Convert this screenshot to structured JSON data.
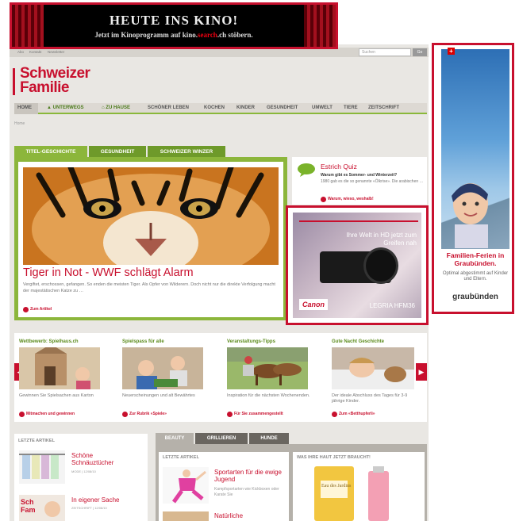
{
  "top_ad": {
    "headline": "HEUTE INS KINO!",
    "sub_pre": "Jetzt im Kinoprogramm auf kino.",
    "sub_brand": "search",
    "sub_post": ".ch stöbern."
  },
  "sky_ad": {
    "headline": "Familien-Ferien in Graubünden.",
    "sub": "Optimal abgestimmt auf Kinder und Eltern.",
    "logo": "graubünden"
  },
  "util": {
    "links": [
      "Abo",
      "Kontakt",
      "Newsletter"
    ],
    "search_placeholder": "Suchen",
    "go": "Go"
  },
  "logo": {
    "line1": "Schweizer",
    "line2": "Familie"
  },
  "nav": [
    "HOME",
    "UNTERWEGS",
    "ZU HAUSE",
    "SCHÖNER LEBEN",
    "KOCHEN",
    "KINDER",
    "GESUNDHEIT",
    "UMWELT",
    "TIERE",
    "ZEITSCHRIFT"
  ],
  "breadcrumb": "Home",
  "feature": {
    "tabs": [
      "TITEL-GESCHICHTE",
      "GESUNDHEIT",
      "SCHWEIZER WINZER"
    ],
    "title": "Tiger in Not - WWF schlägt Alarm",
    "text": "Vergiftet, erschossen, gefangen. So enden die meisten Tiger. Als Opfer von Wilderern. Doch nicht nur die direkte Verfolgung macht der majestätischen Katze zu …",
    "more": "Zum Artikel"
  },
  "quiz": {
    "title": "Estrich Quiz",
    "question": "Warum gibt es Sommer- und Winterzeit?",
    "desc": "1980 gab es die so genannte «Ölkrise». Die arabischen …",
    "more": "Warum, wieso, weshalb!"
  },
  "canon": {
    "headline": "Ihre Welt in HD jetzt zum Greifen nah",
    "brand": "Canon",
    "model": "LEGRIA HFM36"
  },
  "teasers": [
    {
      "title": "Wettbewerb: Spielhaus.ch",
      "desc": "Gewinnen Sie Spielsachen aus Karton",
      "more": "Mitmachen und gewinnen"
    },
    {
      "title": "Spielspass für alle",
      "desc": "Neuerscheinungen und alt Bewährtes",
      "more": "Zur Rubrik «Spiele»"
    },
    {
      "title": "Veranstaltungs-Tipps",
      "desc": "Inspiration für die nächsten Wochenenden.",
      "more": "Für Sie zusammengestellt"
    },
    {
      "title": "Gute Nacht Geschichte",
      "desc": "Der ideale Abschluss des Tages für 3-9 jährige Kinder.",
      "more": "Zum «Betthupferli»"
    }
  ],
  "letzte": {
    "heading": "LETZTE ARTIKEL",
    "items": [
      {
        "title": "Schöne Schnäuztücher",
        "meta": "MODE | 12/08/10"
      },
      {
        "title": "In eigener Sache",
        "meta": "ZEITSCHRIFT | 12/08/10"
      }
    ]
  },
  "bottom_tabs": [
    "BEAUTY",
    "GRILLIEREN",
    "HUNDE"
  ],
  "bottom_left": {
    "heading": "LETZTE ARTIKEL",
    "items": [
      {
        "title": "Sportarten für die ewige Jugend",
        "desc": "Kampfsportarten wie Kickboxen oder Karate Sie"
      },
      {
        "title": "Natürliche"
      }
    ]
  },
  "bottom_right": {
    "heading": "WAS IHRE HAUT JETZT BRAUCHT!",
    "product": "Eau des Jardins"
  }
}
